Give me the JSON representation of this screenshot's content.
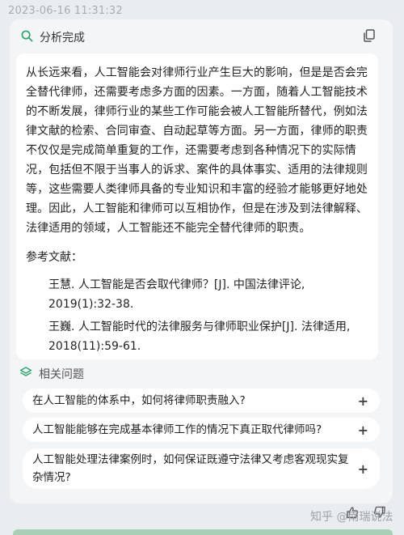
{
  "timestamp": "2023-06-16 11:31:32",
  "status": {
    "label": "分析完成",
    "icon": "search-icon"
  },
  "answer": {
    "body": "从长远来看，人工智能会对律师行业产生巨大的影响，但是是否会完全替代律师，还需要考虑多方面的因素。一方面，随着人工智能技术的不断发展，律师行业的某些工作可能会被人工智能所替代，例如法律文献的检索、合同审查、自动起草等方面。另一方面，律师的职责不仅仅是完成简单重复的工作，还需要考虑到各种情况下的实际情况，包括但不限于当事人的诉求、案件的具体事实、适用的法律规则等，这些需要人类律师具备的专业知识和丰富的经验才能够更好地处理。因此，人工智能和律师可以互相协作，但是在涉及到法律解释、法律适用的领域，人工智能还不能完全替代律师的职责。",
    "references_title": "参考文献：",
    "references": [
      "王慧. 人工智能是否会取代律师？[J]. 中国法律评论, 2019(1):32-38.",
      "王巍. 人工智能时代的法律服务与律师职业保护[J]. 法律适用, 2018(11):59-61."
    ]
  },
  "related": {
    "label": "相关问题",
    "questions": [
      "在人工智能的体系中，如何将律师职责融入?",
      "人工智能能够在完成基本律师工作的情况下真正取代律师吗?",
      "人工智能处理法律案例时，如何保证既遵守法律又考虑客观现实复杂情况?"
    ]
  },
  "watermark": "知乎 @南瑞说法",
  "colors": {
    "accent": "#2fa36b",
    "bottom_bar": "#a9d0b6",
    "card": "#f3f5f7"
  }
}
